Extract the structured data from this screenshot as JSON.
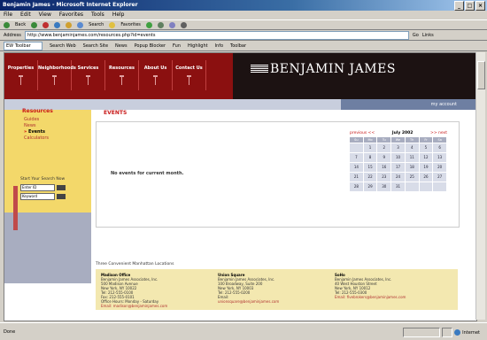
{
  "browser": {
    "title": "Benjamin James - Microsoft Internet Explorer",
    "menu": [
      "File",
      "Edit",
      "View",
      "Favorites",
      "Tools",
      "Help"
    ],
    "toolbar": [
      "Back",
      "Forward",
      "Stop",
      "Refresh",
      "Home",
      "Search",
      "Favorites",
      "Media",
      "History",
      "Mail",
      "Print"
    ],
    "address_label": "Address",
    "address": "http://www.benjaminjames.com/resources.php?id=events",
    "go_label": "Go",
    "links_label": "Links",
    "links_value": "EW Toolbar",
    "links_items": [
      "Search Web",
      "Search Site",
      "News",
      "Popup Blocker",
      "Fun",
      "Highlight",
      "Info",
      "Toolbar"
    ],
    "status": "Done",
    "zone": "Internet"
  },
  "site": {
    "logo": "BENJAMIN JAMES",
    "nav": [
      "Properties",
      "Neighborhoods",
      "Services",
      "Resources",
      "About Us",
      "Contact Us"
    ],
    "account_link": "my account"
  },
  "sidebar": {
    "section_title": "Resources",
    "links": [
      {
        "label": "Guides",
        "active": false
      },
      {
        "label": "News",
        "active": false
      },
      {
        "label": "Events",
        "active": true
      },
      {
        "label": "Calculators",
        "active": false
      }
    ],
    "search_title": "Start Your Search Now",
    "search_fields": [
      "Enter ID",
      "Keyword"
    ]
  },
  "main": {
    "heading": "EVENTS",
    "empty_message": "No events for current month.",
    "calendar": {
      "prev": "previous <<",
      "month": "July 2002",
      "next": ">> next",
      "dow": [
        "Su",
        "Mo",
        "Tu",
        "We",
        "Th",
        "Fr",
        "Sa"
      ],
      "weeks": [
        [
          "",
          "1",
          "2",
          "3",
          "4",
          "5",
          "6"
        ],
        [
          "7",
          "8",
          "9",
          "10",
          "11",
          "12",
          "13"
        ],
        [
          "14",
          "15",
          "16",
          "17",
          "18",
          "19",
          "20"
        ],
        [
          "21",
          "22",
          "23",
          "24",
          "25",
          "26",
          "27"
        ],
        [
          "28",
          "29",
          "30",
          "31",
          "",
          "",
          ""
        ]
      ]
    }
  },
  "footer": {
    "title": "Three Convenient Manhattan Locations",
    "offices": [
      {
        "name": "Madison Office",
        "lines": [
          "Benjamin James Associates, Inc.",
          "500 Madison Avenue",
          "New York, NY 10022",
          "Tel: 212-555-0100",
          "Fax: 212-555-0101",
          "Office Hours: Monday - Saturday"
        ],
        "email": "Email: madison@benjaminjames.com"
      },
      {
        "name": "Union Square",
        "lines": [
          "Benjamin James Associates, Inc.",
          "100 Broadway, Suite 200",
          "New York, NY 10003",
          "Tel: 212-555-0200",
          "Email:"
        ],
        "email": "unionsquare@benjaminjames.com"
      },
      {
        "name": "SoHo",
        "lines": [
          "Benjamin James Associates, Inc.",
          "40 West Houston Street",
          "New York, NY 10012",
          "Tel: 212-555-0300"
        ],
        "email": "Email: fivebrokers@benjaminjames.com"
      }
    ]
  }
}
